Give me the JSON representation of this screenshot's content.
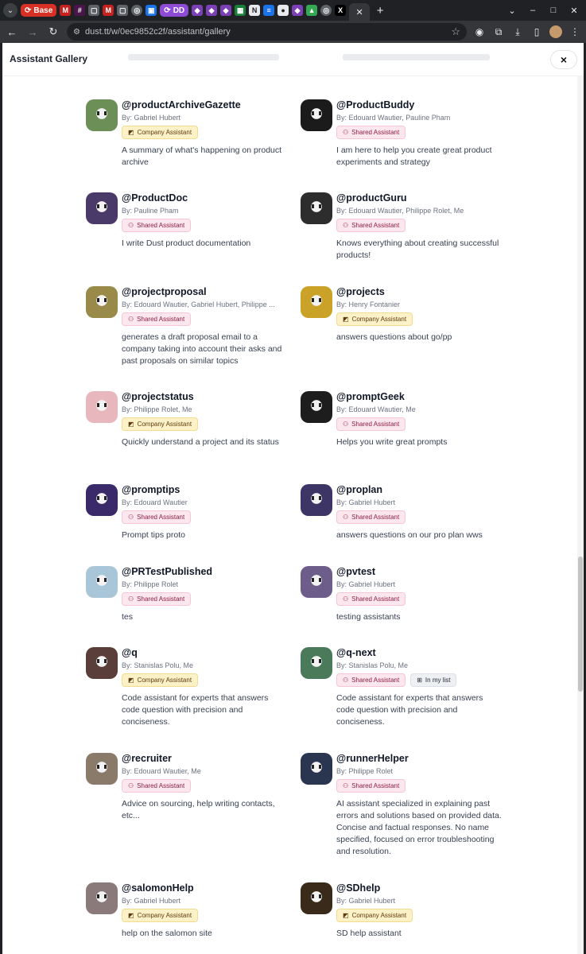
{
  "browser": {
    "tabs": {
      "base_label": "Base",
      "dd_label": "DD",
      "favicon_count": 19
    },
    "url": "dust.tt/w/0ec9852c2f/assistant/gallery"
  },
  "modal": {
    "title": "Assistant Gallery",
    "close_icon": "×"
  },
  "badge_labels": {
    "company": "Company Assistant",
    "shared": "Shared Assistant",
    "inlist": "In my list"
  },
  "assistants": [
    {
      "handle": "@productArchiveGazette",
      "authors": "By: Gabriel Hubert",
      "badges": [
        "company"
      ],
      "description": "A summary of what's happening on product archive",
      "avatar_color": "#6b8f56"
    },
    {
      "handle": "@ProductBuddy",
      "authors": "By: Edouard Wautier, Pauline Pham",
      "badges": [
        "shared"
      ],
      "description": "I am here to help you create great product experiments and strategy",
      "avatar_color": "#1b1b1b"
    },
    {
      "handle": "@ProductDoc",
      "authors": "By: Pauline Pham",
      "badges": [
        "shared"
      ],
      "description": "I write Dust product documentation",
      "avatar_color": "#4a3a6a"
    },
    {
      "handle": "@productGuru",
      "authors": "By: Edouard Wautier, Philippe Rolet, Me",
      "badges": [
        "shared"
      ],
      "description": "Knows everything about creating successful products!",
      "avatar_color": "#2d2d2d"
    },
    {
      "handle": "@projectproposal",
      "authors": "By: Edouard Wautier, Gabriel Hubert, Philippe ...",
      "badges": [
        "shared"
      ],
      "description": "generates a draft proposal email to a company taking into account their asks and past proposals on similar topics",
      "avatar_color": "#9a8a4a"
    },
    {
      "handle": "@projects",
      "authors": "By: Henry Fontanier",
      "badges": [
        "company"
      ],
      "description": "answers questions about go/pp",
      "avatar_color": "#c9a227"
    },
    {
      "handle": "@projectstatus",
      "authors": "By: Philippe Rolet, Me",
      "badges": [
        "company"
      ],
      "description": "Quickly understand a project and its status",
      "avatar_color": "#e8b7bd"
    },
    {
      "handle": "@promptGeek",
      "authors": "By: Edouard Wautier, Me",
      "badges": [
        "shared"
      ],
      "description": "Helps you write great prompts",
      "avatar_color": "#1d1d1d"
    },
    {
      "handle": "@promptips",
      "authors": "By: Edouard Wautier",
      "badges": [
        "shared"
      ],
      "description": "Prompt tips proto",
      "avatar_color": "#3a2a6a"
    },
    {
      "handle": "@proplan",
      "authors": "By: Gabriel Hubert",
      "badges": [
        "shared"
      ],
      "description": "answers questions on our pro plan wws",
      "avatar_color": "#3c3566"
    },
    {
      "handle": "@PRTestPublished",
      "authors": "By: Philippe Rolet",
      "badges": [
        "shared"
      ],
      "description": "tes",
      "avatar_color": "#a9c6d8"
    },
    {
      "handle": "@pvtest",
      "authors": "By: Gabriel Hubert",
      "badges": [
        "shared"
      ],
      "description": "testing assistants",
      "avatar_color": "#6d5d8a"
    },
    {
      "handle": "@q",
      "authors": "By: Stanislas Polu, Me",
      "badges": [
        "company"
      ],
      "description": "Code assistant for experts that answers code question with precision and conciseness.",
      "avatar_color": "#5a3e3a"
    },
    {
      "handle": "@q-next",
      "authors": "By: Stanislas Polu, Me",
      "badges": [
        "shared",
        "inlist"
      ],
      "description": "Code assistant for experts that answers code question with precision and conciseness.",
      "avatar_color": "#4a7a5a"
    },
    {
      "handle": "@recruiter",
      "authors": "By: Edouard Wautier, Me",
      "badges": [
        "shared"
      ],
      "description": "Advice on sourcing, help writing contacts, etc...",
      "avatar_color": "#8a7a6a"
    },
    {
      "handle": "@runnerHelper",
      "authors": "By: Philippe Rolet",
      "badges": [
        "shared"
      ],
      "description": "AI assistant specialized in explaining past errors and solutions based on provided data. Concise and factual responses. No name specified, focused on error troubleshooting and resolution.",
      "avatar_color": "#2a3550"
    },
    {
      "handle": "@salomonHelp",
      "authors": "By: Gabriel Hubert",
      "badges": [
        "company"
      ],
      "description": "help on the salomon site",
      "avatar_color": "#8a7a7a"
    },
    {
      "handle": "@SDhelp",
      "authors": "By: Gabriel Hubert",
      "badges": [
        "company"
      ],
      "description": "SD help assistant",
      "avatar_color": "#3a2a1a"
    }
  ]
}
